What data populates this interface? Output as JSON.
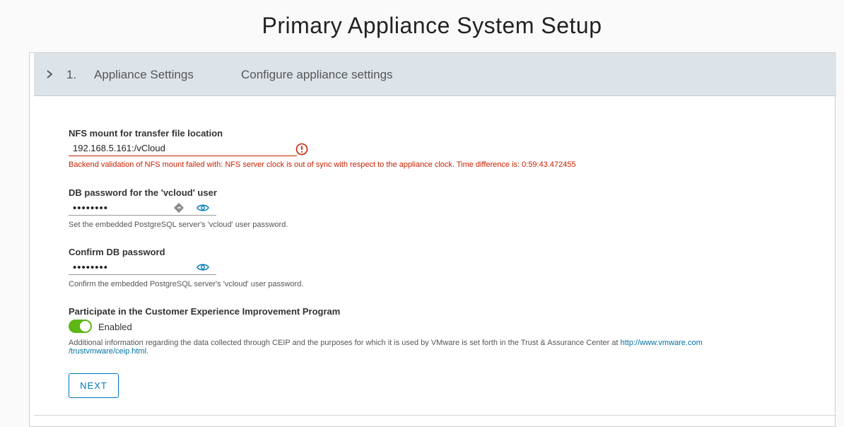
{
  "page": {
    "title": "Primary Appliance System Setup"
  },
  "step": {
    "number": "1.",
    "name": "Appliance Settings",
    "description": "Configure appliance settings"
  },
  "nfs": {
    "label": "NFS mount for transfer file location",
    "value": "192.168.5.161:/vCloud",
    "error": "Backend validation of NFS mount failed with: NFS server clock is out of sync with respect to the appliance clock. Time difference is: 0:59:43.472455"
  },
  "db_password": {
    "label": "DB password for the 'vcloud' user",
    "masked_value": "••••••••",
    "helper": "Set the embedded PostgreSQL server's 'vcloud' user password."
  },
  "confirm_password": {
    "label": "Confirm DB password",
    "masked_value": "••••••••",
    "helper": "Confirm the embedded PostgreSQL server's 'vcloud' user password."
  },
  "ceip": {
    "label": "Participate in the Customer Experience Improvement Program",
    "toggle_state": "Enabled",
    "info_prefix": "Additional information regarding the data collected through CEIP and the purposes for which it is used by VMware is set forth in the Trust & Assurance Center at ",
    "link_text_line1": "http://www.vmware.com",
    "link_text_line2": "/trustvmware/ceip.html",
    "info_suffix": "."
  },
  "actions": {
    "next_label": "NEXT"
  },
  "colors": {
    "error": "#c92100",
    "accent": "#0079b8",
    "toggle_on": "#5eb715",
    "header_bg": "#dce4ea"
  },
  "icons": {
    "step_toggle": "chevron-right-icon",
    "nfs_error": "error-circle-icon",
    "password_manager": "key-diamond-icon",
    "show_password": "eye-icon",
    "show_confirm_password": "eye-icon"
  }
}
